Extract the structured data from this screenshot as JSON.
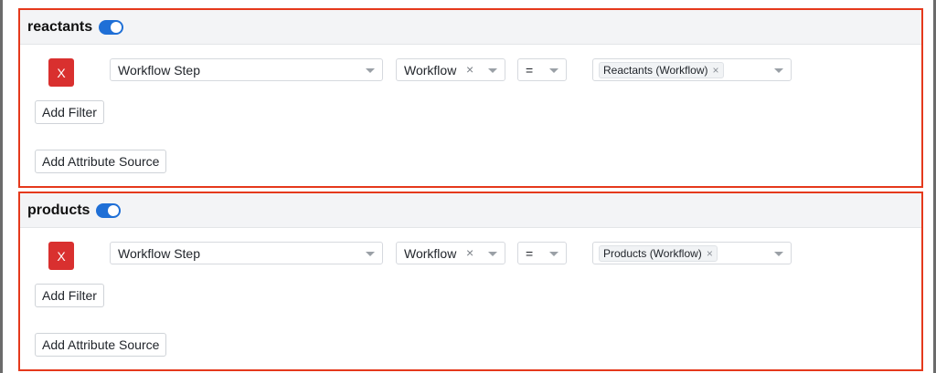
{
  "sections": [
    {
      "title": "reactants",
      "filter": {
        "remove_label": "X",
        "field": "Workflow Step",
        "scope": "Workflow",
        "operator": "=",
        "value_tag": "Reactants (Workflow)"
      },
      "add_filter_label": "Add Filter",
      "add_source_label": "Add Attribute Source"
    },
    {
      "title": "products",
      "filter": {
        "remove_label": "X",
        "field": "Workflow Step",
        "scope": "Workflow",
        "operator": "=",
        "value_tag": "Products (Workflow)"
      },
      "add_filter_label": "Add Filter",
      "add_source_label": "Add Attribute Source"
    }
  ],
  "icons": {
    "clear": "×",
    "caret": "chevron-down-icon"
  },
  "colors": {
    "accent_border": "#e5391c",
    "toggle_on": "#1f6fd6",
    "remove_button": "#d9302f"
  }
}
